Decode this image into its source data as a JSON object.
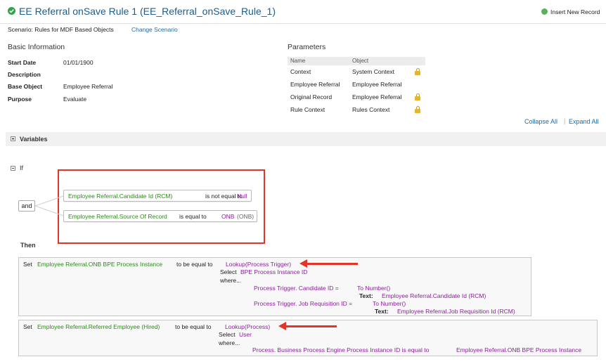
{
  "header": {
    "title": "EE Referral onSave Rule 1 (EE_Referral_onSave_Rule_1)",
    "insert_label": "Insert New Record"
  },
  "scenario": {
    "text": "Scenario: Rules for MDF Based Objects",
    "change_link": "Change Scenario"
  },
  "basic_info": {
    "title": "Basic Information",
    "rows": [
      {
        "label": "Start Date",
        "value": "01/01/1900"
      },
      {
        "label": "Description",
        "value": ""
      },
      {
        "label": "Base Object",
        "value": "Employee Referral"
      },
      {
        "label": "Purpose",
        "value": "Evaluate"
      }
    ]
  },
  "parameters": {
    "title": "Parameters",
    "col_name": "Name",
    "col_object": "Object",
    "rows": [
      {
        "name": "Context",
        "object": "System Context",
        "locked": true
      },
      {
        "name": "Employee Referral",
        "object": "Employee Referral",
        "locked": false
      },
      {
        "name": "Original Record",
        "object": "Employee Referral",
        "locked": true
      },
      {
        "name": "Rule Context",
        "object": "Rules Context",
        "locked": true
      }
    ]
  },
  "actions": {
    "collapse_all": "Collapse All",
    "separator": "|",
    "expand_all": "Expand All"
  },
  "variables": {
    "label": "Variables"
  },
  "if_section": {
    "label": "If",
    "operator": "and",
    "conditions": [
      {
        "field": "Employee Referral.Candidate Id (RCM)",
        "op": "is not equal to",
        "value": "Null",
        "value_extra": ""
      },
      {
        "field": "Employee Referral.Source Of Record",
        "op": "is equal to",
        "value": "ONB",
        "value_extra": "(ONB)"
      }
    ]
  },
  "then_section": {
    "label": "Then",
    "statements": [
      {
        "set": "Set",
        "field": "Employee Referral.ONB BPE Process Instance",
        "op": "to be equal to",
        "lookup": "Lookup(Process Trigger)",
        "select_prefix": "Select",
        "select_field": "BPE Process Instance ID",
        "where": "where...",
        "clauses": [
          {
            "left": "Process Trigger. Candidate ID =",
            "func": "To Number()",
            "text_label": "Text:",
            "text_value": "Employee Referral.Candidate Id (RCM)"
          },
          {
            "left": "Process Trigger. Job Requisition ID =",
            "func": "To Number()",
            "text_label": "Text:",
            "text_value": "Employee Referral.Job Requisition Id (RCM)"
          }
        ]
      },
      {
        "set": "Set",
        "field": "Employee Referral.Referred Employee (Hired)",
        "op": "to be equal to",
        "lookup": "Lookup(Process)",
        "select_prefix": "Select",
        "select_field": "User",
        "where": "where...",
        "clause_left": "Process. Business Process Engine Process Instance ID is equal to",
        "clause_right": "Employee Referral.ONB BPE Process Instance"
      }
    ]
  },
  "colors": {
    "field_green": "#2a8a18",
    "value_purple": "#8a1f9a",
    "link_blue": "#1a6aa8",
    "highlight_red": "#e3342a",
    "lock_gold": "#e6b52a"
  }
}
